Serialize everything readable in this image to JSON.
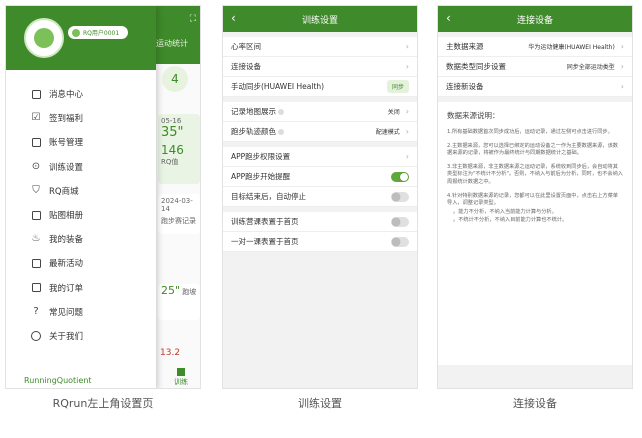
{
  "phone1": {
    "username": "RQ用户0001",
    "menu": [
      {
        "label": "消息中心",
        "icon": "message-icon"
      },
      {
        "label": "签到福利",
        "icon": "checkin-icon"
      },
      {
        "label": "账号管理",
        "icon": "account-icon"
      },
      {
        "label": "训练设置",
        "icon": "settings-icon"
      },
      {
        "label": "RQ商城",
        "icon": "shop-icon"
      },
      {
        "label": "贴图相册",
        "icon": "album-icon"
      },
      {
        "label": "我的装备",
        "icon": "gear-equipment-icon"
      },
      {
        "label": "最新活动",
        "icon": "gift-icon"
      },
      {
        "label": "我的订单",
        "icon": "order-icon"
      },
      {
        "label": "常见问题",
        "icon": "faq-icon"
      },
      {
        "label": "关于我们",
        "icon": "info-icon"
      }
    ],
    "brand": "RunningQuotient",
    "background": {
      "tab": "运动统计",
      "card1_date": "05-16",
      "card1_value": "35\"",
      "card2_value": "146",
      "card2_unit": "RQ值",
      "card3_date": "2024-03-14",
      "card3_text": "跑步赛记录",
      "card4_value": "25\"",
      "card4_text": "跑坡",
      "card5_value": "13.2",
      "nav": "训练",
      "badge": "4"
    }
  },
  "phone2": {
    "title": "训练设置",
    "rows": [
      {
        "label": "心率区间",
        "type": "link"
      },
      {
        "label": "连接设备",
        "type": "link"
      },
      {
        "label": "手动同步(HUAWEI Health)",
        "type": "badge",
        "value": "同步"
      },
      {
        "label": "记录地图展示",
        "type": "value",
        "value": "关闭"
      },
      {
        "label": "跑步轨迹颜色",
        "type": "value",
        "value": "配速模式"
      },
      {
        "label": "APP跑步权限设置",
        "type": "link"
      },
      {
        "label": "APP跑步开始提醒",
        "type": "toggle",
        "on": true
      },
      {
        "label": "目标结束后，自动停止",
        "type": "toggle",
        "on": false
      },
      {
        "label": "训练营课表置于首页",
        "type": "toggle",
        "on": false
      },
      {
        "label": "一对一课表置于首页",
        "type": "toggle",
        "on": false
      }
    ]
  },
  "phone3": {
    "title": "连接设备",
    "rows": [
      {
        "label": "主数据来源",
        "value": "华为运动健康(HUAWEI Health)"
      },
      {
        "label": "数据类型同步设置",
        "value": "同步全部运动类型"
      },
      {
        "label": "连接新设备",
        "value": ""
      }
    ],
    "explain_title": "数据来源说明：",
    "explain": [
      "1.所有基础数据首次同步成功后，运动记录，通过左侧可点击进行同步。",
      "2.主数据来源，您可以选择已绑定的运动设备之一作为主要数据来源，该数据来源的记录，将被作为最终统计与同期数据统计之基础。",
      "3.非主数据来源，非主数据来源之运动记录，系统收到同步后，会自动将其类型标注为\"不统计不分析\"。否则，不纳入与前后为分析，同时，也不会纳入周报统计数据之中。",
      "4.针对特别数据来源的记录，您都可以在此里设置页面中，点击右上方菜单导入，调整记录类型。",
      "。能力不分析，不纳入当前能力计算与分析。",
      "。不统计不分析，不纳入目前能力计算也不统计。"
    ]
  },
  "captions": {
    "c1": "RQrun左上角设置页",
    "c2": "训练设置",
    "c3": "连接设备"
  },
  "colors": {
    "brand_green": "#3f8a2a",
    "toggle_on": "#5ea83c"
  }
}
